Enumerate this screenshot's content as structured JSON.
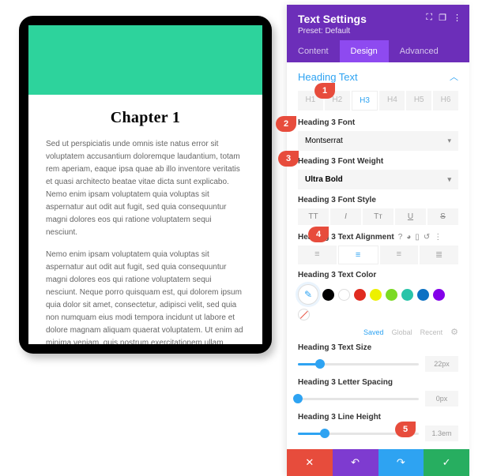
{
  "preview": {
    "chapter_title": "Chapter 1",
    "para1": "Sed ut perspiciatis unde omnis iste natus error sit voluptatem accusantium doloremque laudantium, totam rem aperiam, eaque ipsa quae ab illo inventore veritatis et quasi architecto beatae vitae dicta sunt explicabo. Nemo enim ipsam voluptatem quia voluptas sit aspernatur aut odit aut fugit, sed quia consequuntur magni dolores eos qui ratione voluptatem sequi nesciunt.",
    "para2": "Nemo enim ipsam voluptatem quia voluptas sit aspernatur aut odit aut fugit, sed quia consequuntur magni dolores eos qui ratione voluptatem sequi nesciunt. Neque porro quisquam est, qui dolorem ipsum quia dolor sit amet, consectetur, adipisci velit, sed quia non numquam eius modi tempora incidunt ut labore et dolore magnam aliquam quaerat voluptatem. Ut enim ad minima veniam, quis nostrum exercitationem ullam corporis suscipit laboriosam, nisi ut aliquid ex ea commodi consequatur? Quis autem vel eum iure reprehenderit qui."
  },
  "panel": {
    "title": "Text Settings",
    "preset": "Preset: Default",
    "tabs": {
      "content": "Content",
      "design": "Design",
      "advanced": "Advanced"
    },
    "section": "Heading Text",
    "heading_levels": [
      "H1",
      "H2",
      "H3",
      "H4",
      "H5",
      "H6"
    ],
    "font_label": "Heading 3 Font",
    "font_value": "Montserrat",
    "weight_label": "Heading 3 Font Weight",
    "weight_value": "Ultra Bold",
    "style_label": "Heading 3 Font Style",
    "align_label": "Heading 3 Text Alignment",
    "color_label": "Heading 3 Text Color",
    "saved": "Saved",
    "global": "Global",
    "recent": "Recent",
    "size_label": "Heading 3 Text Size",
    "size_value": "22px",
    "spacing_label": "Heading 3 Letter Spacing",
    "spacing_value": "0px",
    "lineheight_label": "Heading 3 Line Height",
    "lineheight_value": "1.3em",
    "swatches": [
      "#000000",
      "#ffffff",
      "#e02b20",
      "#edf000",
      "#7cda24",
      "#0c71c3",
      "#29c4a9",
      "#8300e9",
      "#ffffff"
    ]
  },
  "callouts": {
    "c1": "1",
    "c2": "2",
    "c3": "3",
    "c4": "4",
    "c5": "5"
  }
}
